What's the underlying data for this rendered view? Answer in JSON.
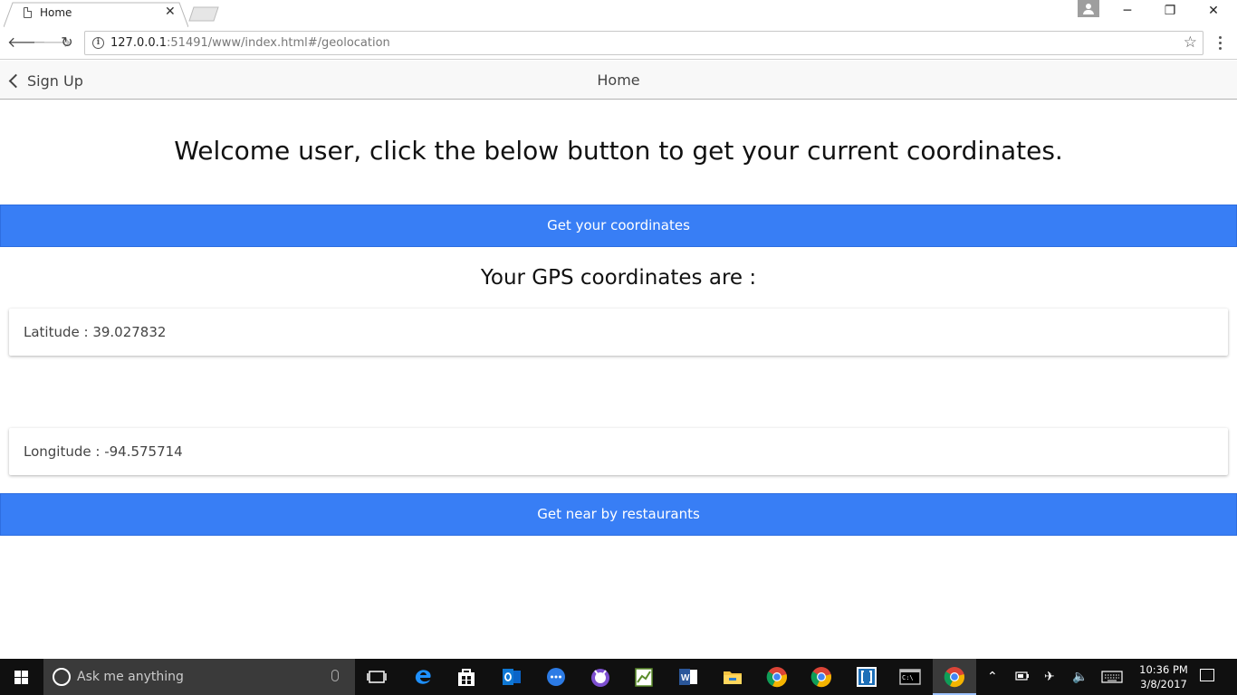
{
  "browser": {
    "tab_title": "Home",
    "url_host": "127.0.0.1",
    "url_rest": ":51491/www/index.html#/geolocation"
  },
  "app": {
    "back_label": "Sign Up",
    "header_title": "Home",
    "welcome_text": "Welcome user, click the below button to get your current coordinates.",
    "get_coords_button": "Get your coordinates",
    "gps_heading": "Your GPS coordinates are :",
    "latitude_text": "Latitude : 39.027832",
    "longitude_text": "Longitude : -94.575714",
    "restaurants_button": "Get near by restaurants",
    "accent_color": "#387ef5"
  },
  "taskbar": {
    "search_placeholder": "Ask me anything",
    "time": "10:36 PM",
    "date": "3/8/2017"
  }
}
